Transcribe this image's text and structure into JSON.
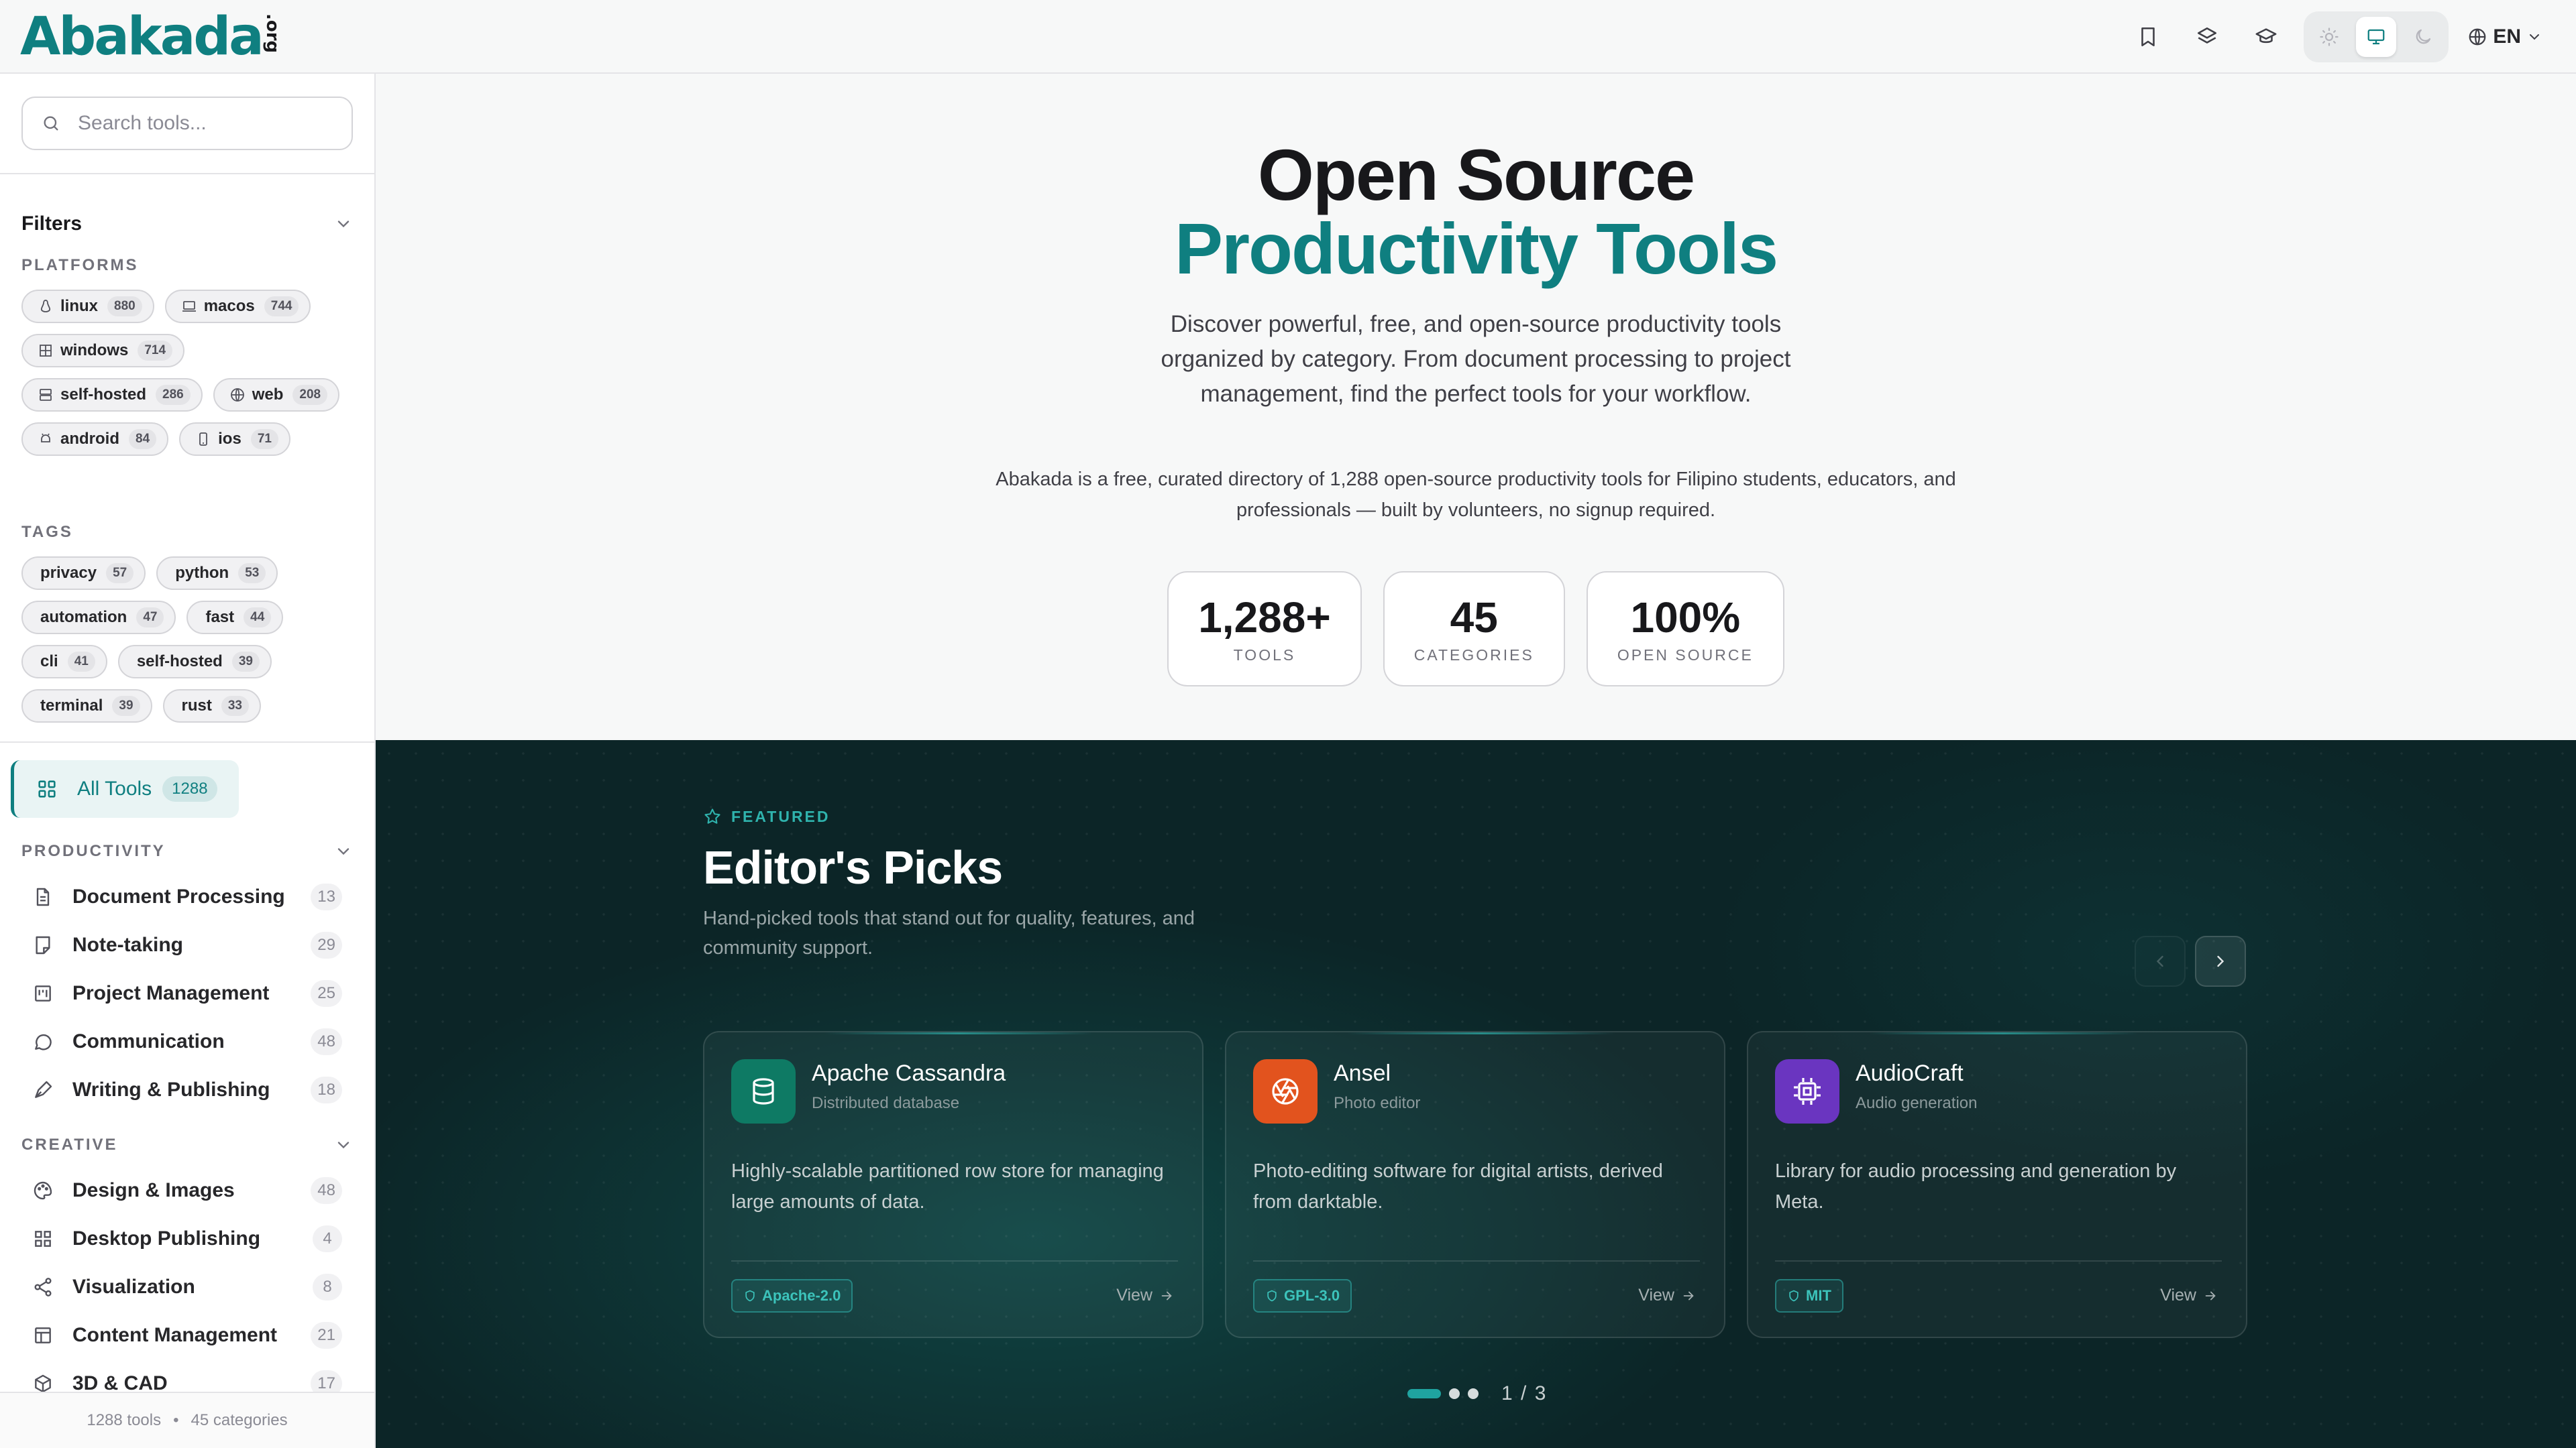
{
  "header": {
    "logo_text": "Abakada",
    "logo_suffix": ".org",
    "language": "EN",
    "icons": [
      "bookmark-icon",
      "layers-icon",
      "graduation-cap-icon",
      "sun-icon",
      "monitor-icon",
      "moon-icon",
      "globe-icon"
    ],
    "theme_active": "system"
  },
  "sidebar": {
    "search_placeholder": "Search tools...",
    "filters_label": "Filters",
    "platforms_label": "PLATFORMS",
    "platforms": [
      {
        "label": "linux",
        "count": "880"
      },
      {
        "label": "macos",
        "count": "744"
      },
      {
        "label": "windows",
        "count": "714"
      },
      {
        "label": "self-hosted",
        "count": "286"
      },
      {
        "label": "web",
        "count": "208"
      },
      {
        "label": "android",
        "count": "84"
      },
      {
        "label": "ios",
        "count": "71"
      }
    ],
    "tags_label": "TAGS",
    "tags": [
      {
        "label": "privacy",
        "count": "57"
      },
      {
        "label": "python",
        "count": "53"
      },
      {
        "label": "automation",
        "count": "47"
      },
      {
        "label": "fast",
        "count": "44"
      },
      {
        "label": "cli",
        "count": "41"
      },
      {
        "label": "self-hosted",
        "count": "39"
      },
      {
        "label": "terminal",
        "count": "39"
      },
      {
        "label": "rust",
        "count": "33"
      }
    ],
    "all_tools": {
      "label": "All Tools",
      "count": "1288"
    },
    "groups": [
      {
        "label": "PRODUCTIVITY",
        "items": [
          {
            "label": "Document Processing",
            "count": "13"
          },
          {
            "label": "Note-taking",
            "count": "29"
          },
          {
            "label": "Project Management",
            "count": "25"
          },
          {
            "label": "Communication",
            "count": "48"
          },
          {
            "label": "Writing & Publishing",
            "count": "18"
          }
        ]
      },
      {
        "label": "CREATIVE",
        "items": [
          {
            "label": "Design & Images",
            "count": "48"
          },
          {
            "label": "Desktop Publishing",
            "count": "4"
          },
          {
            "label": "Visualization",
            "count": "8"
          },
          {
            "label": "Content Management",
            "count": "21"
          },
          {
            "label": "3D & CAD",
            "count": "17"
          }
        ]
      }
    ],
    "footer": {
      "tools": "1288 tools",
      "sep": "•",
      "categories": "45 categories"
    }
  },
  "hero": {
    "title_line1": "Open Source",
    "title_line2": "Productivity Tools",
    "subtitle": "Discover powerful, free, and open-source productivity tools organized by category. From document processing to project management, find the perfect tools for your workflow.",
    "description": "Abakada is a free, curated directory of 1,288 open-source productivity tools for Filipino students, educators, and professionals — built by volunteers, no signup required.",
    "stats": [
      {
        "value": "1,288+",
        "label": "TOOLS"
      },
      {
        "value": "45",
        "label": "CATEGORIES"
      },
      {
        "value": "100%",
        "label": "OPEN SOURCE"
      }
    ]
  },
  "featured": {
    "kicker": "FEATURED",
    "title": "Editor's Picks",
    "subtitle": "Hand-picked tools that stand out for quality, features, and community support.",
    "cards": [
      {
        "name": "Apache Cassandra",
        "kind": "Distributed database",
        "desc": "Highly-scalable partitioned row store for managing large amounts of data.",
        "license": "Apache-2.0",
        "view": "View",
        "icon": "database-icon",
        "color": "#0e7a64"
      },
      {
        "name": "Ansel",
        "kind": "Photo editor",
        "desc": "Photo-editing software for digital artists, derived from darktable.",
        "license": "GPL-3.0",
        "view": "View",
        "icon": "aperture-icon",
        "color": "#e2531e"
      },
      {
        "name": "AudioCraft",
        "kind": "Audio generation",
        "desc": "Library for audio processing and generation by Meta.",
        "license": "MIT",
        "view": "View",
        "icon": "cpu-icon",
        "color": "#6a35c0"
      }
    ],
    "pager": {
      "current": "1",
      "sep": "/",
      "total": "3"
    }
  },
  "colors": {
    "accent": "#0f7f80",
    "dark_bg": "#0c2527",
    "license_teal": "#3cc3bb"
  }
}
